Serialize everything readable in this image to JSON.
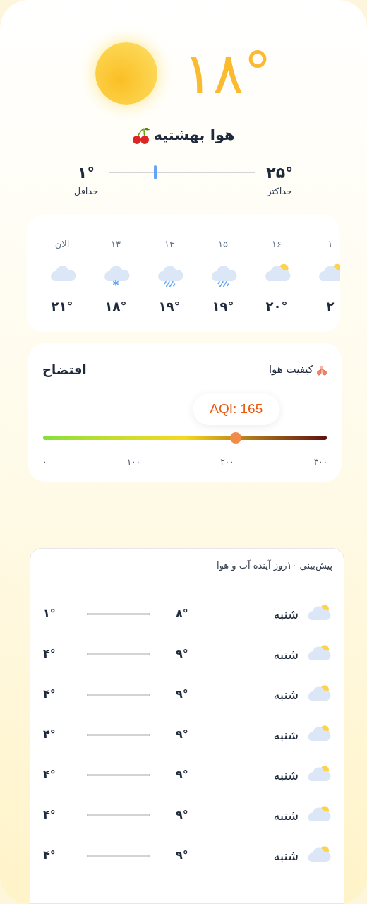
{
  "current": {
    "temperature": "۱۸°",
    "condition": "هوا بهشتیه"
  },
  "range": {
    "min": "۱°",
    "min_label": "حداقل",
    "max": "۲۵°",
    "max_label": "حداکثر",
    "level": 0.3
  },
  "hourly": [
    {
      "time": "۱",
      "kind": "partly",
      "temp": "۲"
    },
    {
      "time": "۱۶",
      "kind": "partly",
      "temp": "۲۰°"
    },
    {
      "time": "۱۵",
      "kind": "rain",
      "temp": "۱۹°"
    },
    {
      "time": "۱۴",
      "kind": "rain",
      "temp": "۱۹°"
    },
    {
      "time": "۱۳",
      "kind": "snow",
      "temp": "۱۸°"
    },
    {
      "time": "الان",
      "kind": "cloud",
      "temp": "۲۱°"
    }
  ],
  "air_quality": {
    "title": "کیفیت هوا",
    "status": "افتضاح",
    "reading": "AQI: 165",
    "level": 0.68,
    "ticks": [
      "۳۰۰",
      "۲۰۰",
      "۱۰۰",
      "۰"
    ]
  },
  "forecast": {
    "title": "پیش‌بینی ۱۰روز آینده آب و هوا",
    "days": [
      {
        "day": "شنبه",
        "kind": "partly",
        "max": "۸°",
        "min": "۱°"
      },
      {
        "day": "شنبه",
        "kind": "partly",
        "max": "۹°",
        "min": "۴°"
      },
      {
        "day": "شنبه",
        "kind": "partly",
        "max": "۹°",
        "min": "۴°"
      },
      {
        "day": "شنبه",
        "kind": "partly",
        "max": "۹°",
        "min": "۴°"
      },
      {
        "day": "شنبه",
        "kind": "partly",
        "max": "۹°",
        "min": "۴°"
      },
      {
        "day": "شنبه",
        "kind": "partly",
        "max": "۹°",
        "min": "۴°"
      },
      {
        "day": "شنبه",
        "kind": "partly",
        "max": "۹°",
        "min": "۴°"
      }
    ]
  }
}
